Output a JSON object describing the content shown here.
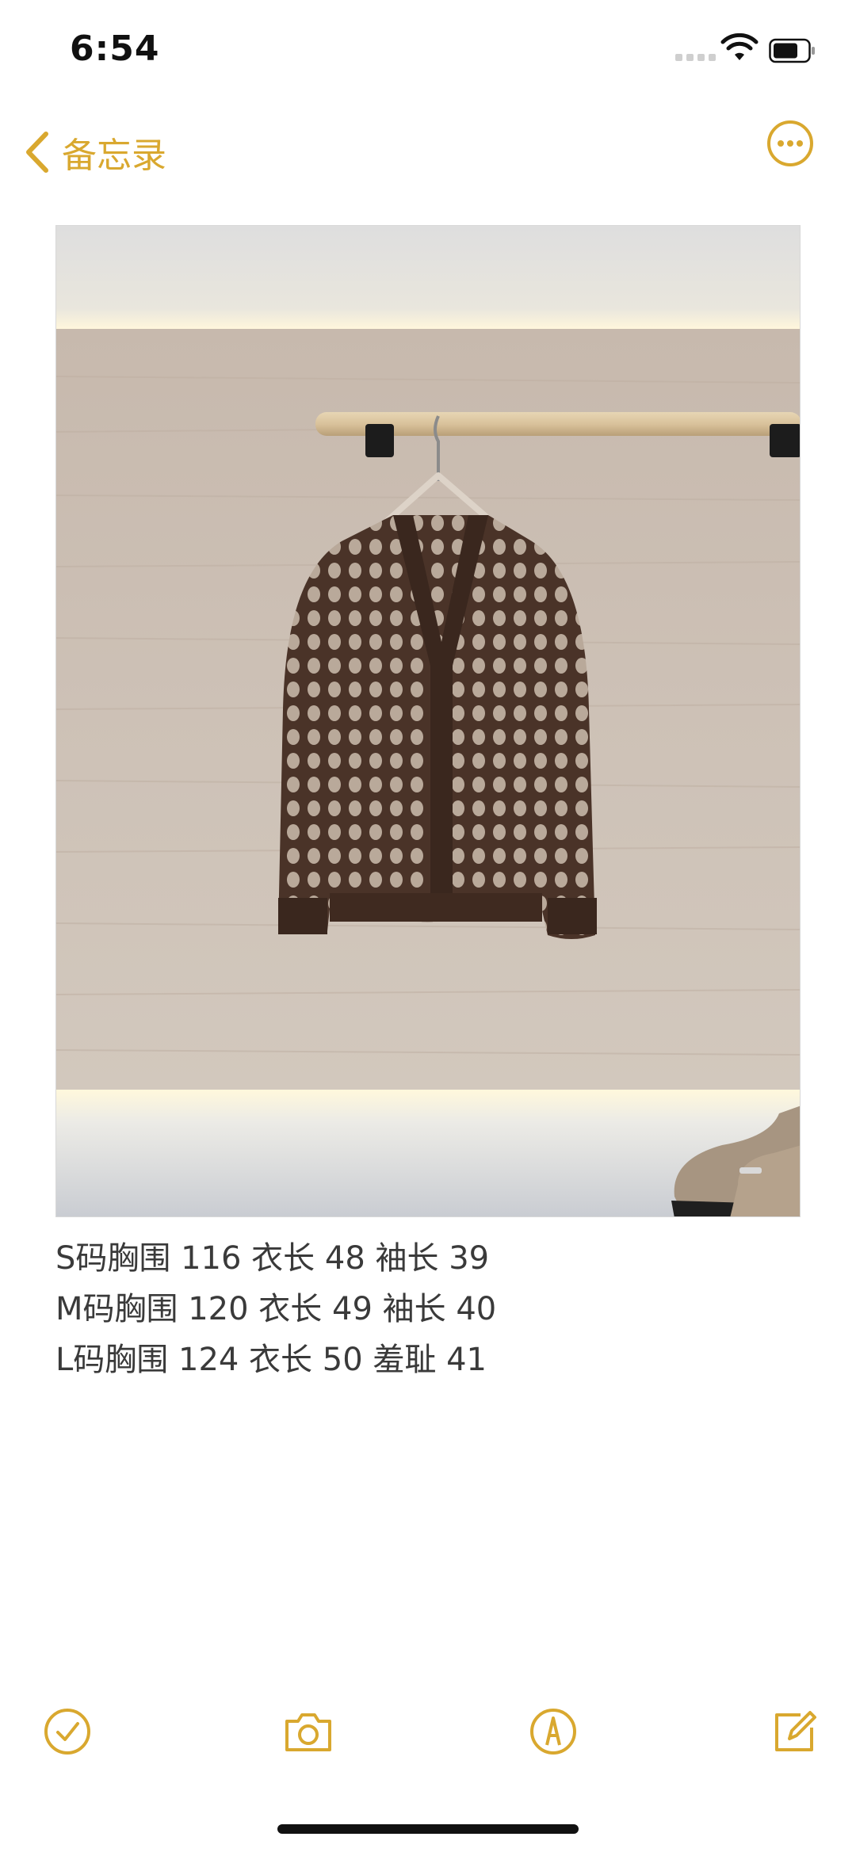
{
  "status_bar": {
    "time": "6:54"
  },
  "nav": {
    "back_label": "备忘录",
    "accent_color": "#d9a82f"
  },
  "note": {
    "photo_subject": "brown open-knit cardigan on hanger",
    "lines": [
      "S码胸围 116 衣长 48 袖长 39",
      "M码胸围 120 衣长 49 袖长 40",
      "L码胸围 124 衣长 50 羞耻 41"
    ]
  },
  "toolbar": {
    "icons": [
      "checklist-icon",
      "camera-icon",
      "markup-icon",
      "compose-icon"
    ]
  }
}
